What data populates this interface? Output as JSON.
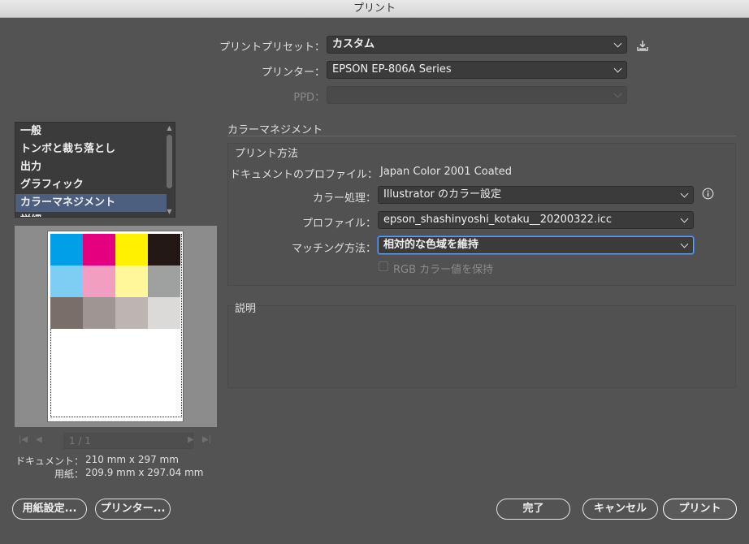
{
  "window": {
    "title": "プリント"
  },
  "preset": {
    "label": "プリントプリセット：",
    "value": "カスタム"
  },
  "printer": {
    "label": "プリンター：",
    "value": "EPSON EP-806A Series"
  },
  "ppd": {
    "label": "PPD：",
    "value": ""
  },
  "sidebar": {
    "items": [
      {
        "label": "一般"
      },
      {
        "label": "トンボと裁ち落とし"
      },
      {
        "label": "出力"
      },
      {
        "label": "グラフィック"
      },
      {
        "label": "カラーマネジメント"
      },
      {
        "label": "詳細"
      }
    ],
    "selected_index": 4
  },
  "color_management": {
    "section_title": "カラーマネジメント",
    "print_method": {
      "title": "プリント方法",
      "doc_profile_label": "ドキュメントのプロファイル：",
      "doc_profile_value": "Japan Color 2001 Coated",
      "color_handling_label": "カラー処理：",
      "color_handling_value": "Illustrator のカラー設定",
      "profile_label": "プロファイル：",
      "profile_value": "epson_shashinyoshi_kotaku__20200322.icc",
      "matching_label": "マッチング方法：",
      "matching_value": "相対的な色域を維持",
      "preserve_rgb_label": "RGB カラー値を保持",
      "preserve_rgb_checked": false
    },
    "description": {
      "title": "説明",
      "text": ""
    }
  },
  "preview": {
    "swatch_colors": [
      "#00a0e9",
      "#e4007f",
      "#fff100",
      "#231815",
      "#7ecef4",
      "#f19ec2",
      "#fff799",
      "#9fa0a0",
      "#786e6a",
      "#9e9693",
      "#bcb5b2",
      "#dcdad8"
    ],
    "page_field": "1 / 1",
    "document_label": "ドキュメント：",
    "document_size": "210 mm x 297 mm",
    "paper_label": "用紙：",
    "paper_size": "209.9 mm x 297.04 mm"
  },
  "buttons": {
    "page_setup": "用紙設定...",
    "printer": "プリンター...",
    "done": "完了",
    "cancel": "キャンセル",
    "print": "プリント"
  },
  "icons": {
    "save_preset": "download-icon",
    "info": "info-icon"
  }
}
